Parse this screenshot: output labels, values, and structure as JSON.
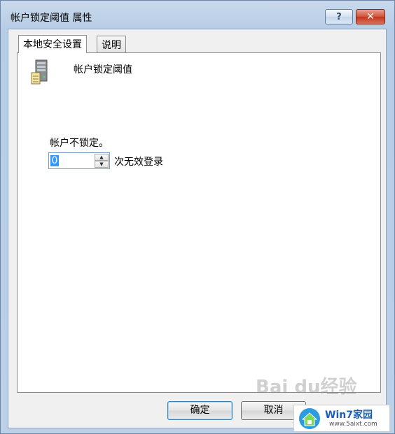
{
  "window": {
    "title": "帐户锁定阈值 属性",
    "help_label": "?",
    "close_label": "✕"
  },
  "tabs": [
    {
      "label": "本地安全设置",
      "active": true
    },
    {
      "label": "说明",
      "active": false
    }
  ],
  "policy": {
    "icon": "server-icon",
    "name": "帐户锁定阈值"
  },
  "setting": {
    "label": "帐户不锁定。",
    "value": "0",
    "suffix": "次无效登录"
  },
  "buttons": {
    "ok": "确定",
    "cancel": "取消"
  },
  "watermark": {
    "text": "Bai du经验"
  },
  "badge": {
    "title": "Win7家园",
    "url": "www.5aixt.com"
  },
  "colors": {
    "title_bar": "#bcd0e8",
    "selection": "#3399ff",
    "close": "#c2361c"
  }
}
